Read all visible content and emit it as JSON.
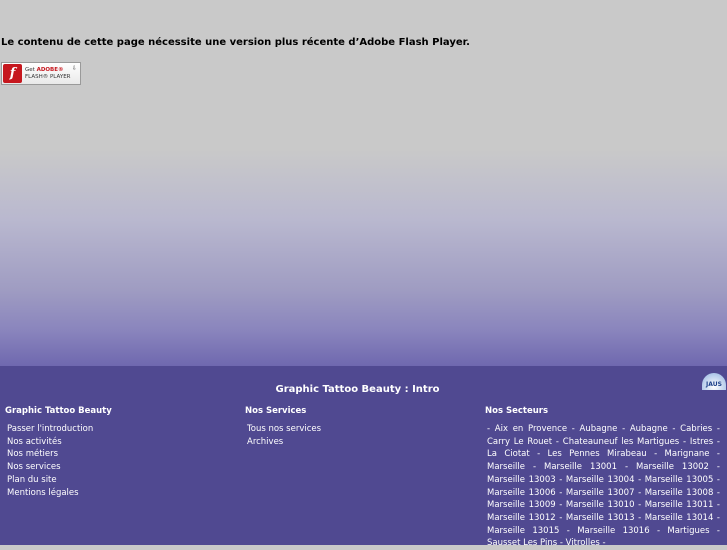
{
  "flash": {
    "message": "Le contenu de cette page nécessite une version plus récente d’Adobe Flash Player.",
    "badge": {
      "line1_prefix": "Get ",
      "line1_brand": "ADOBE®",
      "line2": "FLASH® PLAYER",
      "logo": "f"
    }
  },
  "footer": {
    "title": "Graphic Tattoo Beauty : Intro",
    "badge_label": "JAUS",
    "columns": [
      {
        "heading": "Graphic Tattoo Beauty",
        "links": [
          "Passer l'introduction",
          "Nos activités",
          "Nos métiers",
          "Nos services",
          "Plan du site",
          "Mentions légales"
        ]
      },
      {
        "heading": "Nos Services",
        "links": [
          "Tous nos services",
          "Archives"
        ]
      },
      {
        "heading": "Nos Secteurs",
        "text": "- Aix en Provence - Aubagne - Aubagne - Cabries - Carry Le Rouet - Chateauneuf les Martigues - Istres - La Ciotat - Les Pennes Mirabeau - Marignane - Marseille - Marseille 13001 - Marseille 13002 - Marseille 13003 - Marseille 13004 - Marseille 13005 - Marseille 13006 - Marseille 13007 - Marseille 13008 - Marseille 13009 - Marseille 13010 - Marseille 13011 - Marseille 13012 - Marseille 13013 - Marseille 13014 - Marseille 13015 - Marseille 13016 - Martigues - Sausset Les Pins - Vitrolles -"
      }
    ]
  },
  "colors": {
    "footer_bg": "#504991",
    "flash_red": "#c6171e",
    "top_gray": "#c9c9c9"
  }
}
